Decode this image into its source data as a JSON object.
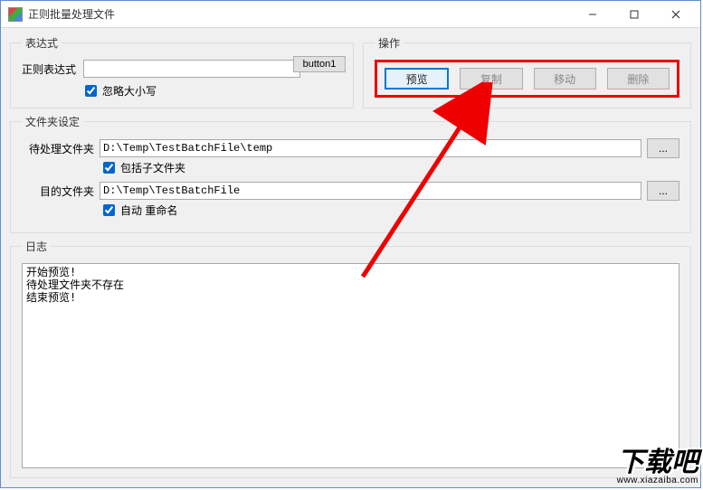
{
  "titlebar": {
    "title": "正则批量处理文件"
  },
  "expression": {
    "legend": "表达式",
    "label": "正则表达式",
    "value": "",
    "button1": "button1",
    "ignore_case_label": "忽略大小写",
    "ignore_case_checked": true
  },
  "operations": {
    "legend": "操作",
    "preview": "预览",
    "copy": "复制",
    "move": "移动",
    "delete": "删除"
  },
  "folders": {
    "legend": "文件夹设定",
    "source_label": "待处理文件夹",
    "source_value": "D:\\Temp\\TestBatchFile\\temp",
    "include_sub_label": "包括子文件夹",
    "include_sub_checked": true,
    "dest_label": "目的文件夹",
    "dest_value": "D:\\Temp\\TestBatchFile",
    "auto_rename_label": "自动 重命名",
    "auto_rename_checked": true,
    "browse": "..."
  },
  "log": {
    "legend": "日志",
    "content": "开始预览!\n待处理文件夹不存在\n结束预览!"
  },
  "watermark": {
    "big": "下载吧",
    "url": "www.xiazaiba.com"
  }
}
